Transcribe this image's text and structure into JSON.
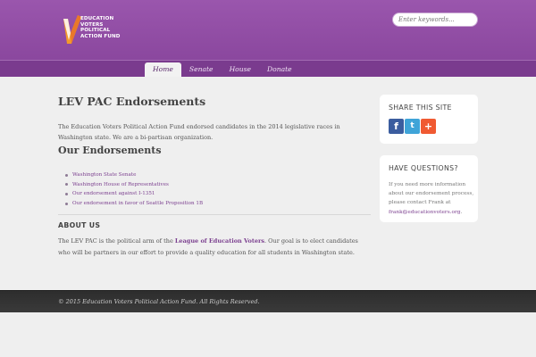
{
  "header": {
    "logo_lines": [
      "EDUCATION",
      "VOTERS",
      "POLITICAL",
      "ACTION FUND"
    ],
    "search_placeholder": "Enter keywords..."
  },
  "nav": {
    "items": [
      "Home",
      "Senate",
      "House",
      "Donate"
    ],
    "active": "Home"
  },
  "main": {
    "title": "LEV PAC Endorsements",
    "intro": "The Education Voters Political Action Fund endorsed candidates in the 2014 legislative races in Washington state. We are a bi-partisan organization.",
    "endorsements_title": "Our Endorsements",
    "endorsements": [
      "Washington State Senate",
      "Washington House of Representatives",
      "Our endorsement against I-1351",
      "Our endorsement in favor of Seattle Proposition 1B"
    ],
    "about_title": "ABOUT US",
    "about_before": "The LEV PAC is the political arm of the ",
    "about_link": "League of Education Voters",
    "about_after": ". Our goal is to elect candidates who will be partners in our effort to provide a quality education for all students in Washington state."
  },
  "sidebar": {
    "share_title": "SHARE THIS SITE",
    "share_icons": [
      "facebook-icon",
      "twitter-icon",
      "addthis-plus-icon"
    ],
    "questions_title": "HAVE QUESTIONS?",
    "questions_text": "If you need more information about our endorsement process, please contact Frank at ",
    "questions_email": "frank@educationvoters.org",
    "questions_end": "."
  },
  "footer": {
    "text": "© 2015 Education Voters Political Action Fund. All Rights Reserved."
  },
  "colors": {
    "header_purple": "#8c479f",
    "link_purple": "#7b3f8f",
    "footer_dark": "#333333",
    "logo_orange": "#f39a2a"
  }
}
